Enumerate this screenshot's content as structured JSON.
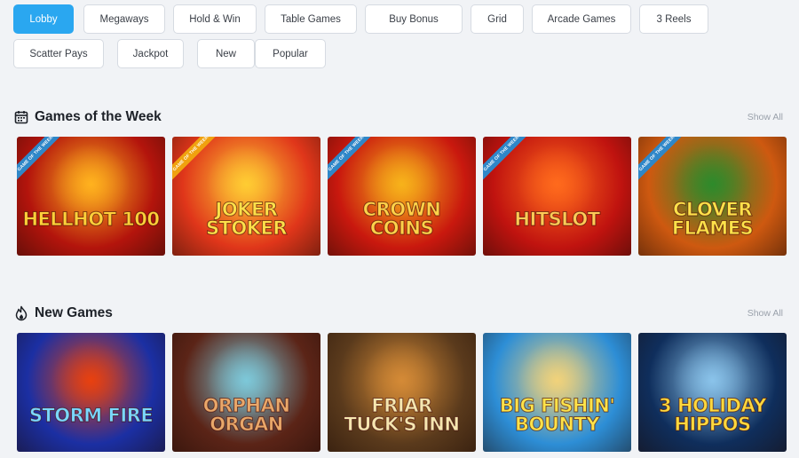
{
  "filters": [
    {
      "label": "Lobby",
      "active": true
    },
    {
      "label": "Megaways",
      "active": false
    },
    {
      "label": "Hold & Win",
      "active": false
    },
    {
      "label": "Table Games",
      "active": false
    },
    {
      "label": "Buy Bonus",
      "active": false
    },
    {
      "label": "Grid",
      "active": false
    },
    {
      "label": "Arcade Games",
      "active": false
    },
    {
      "label": "3 Reels",
      "active": false
    },
    {
      "label": "Scatter Pays",
      "active": false
    },
    {
      "label": "Jackpot",
      "active": false
    },
    {
      "label": "New",
      "active": false
    },
    {
      "label": "Popular",
      "active": false
    }
  ],
  "sections": {
    "week": {
      "title": "Games of the Week",
      "icon": "calendar-icon",
      "show_all": "Show All",
      "ribbon": "GAME OF THE WEEK",
      "games": [
        {
          "title": "HellHot 100",
          "bg": "#b3140c",
          "accent": "#ffb21e",
          "text": "#ffd03a"
        },
        {
          "title": "Joker Stoker",
          "bg": "#e0361a",
          "accent": "#ffcc33",
          "text": "#ffe04a"
        },
        {
          "title": "Crown Coins",
          "bg": "#c9180e",
          "accent": "#f7b21a",
          "text": "#ffd24a"
        },
        {
          "title": "Hitslot",
          "bg": "#c0130f",
          "accent": "#ff6a1c",
          "text": "#ffcb57"
        },
        {
          "title": "Clover Flames",
          "bg": "#ce5910",
          "accent": "#2e8a2b",
          "text": "#ffe24a"
        }
      ]
    },
    "new": {
      "title": "New Games",
      "icon": "flame-icon",
      "show_all": "Show All",
      "games": [
        {
          "title": "Storm Fire",
          "bg": "#1b2fa3",
          "accent": "#e8410f",
          "text": "#7ad8ff"
        },
        {
          "title": "Orphan Organ",
          "bg": "#5b2417",
          "accent": "#7dc8d9",
          "text": "#e9a86a"
        },
        {
          "title": "Friar Tuck's Inn",
          "bg": "#5a3a1c",
          "accent": "#d48a36",
          "text": "#f6e7b0"
        },
        {
          "title": "Big Fishin' Bounty",
          "bg": "#2d8ed6",
          "accent": "#f1d27a",
          "text": "#ffe34a"
        },
        {
          "title": "3 Holiday Hippos",
          "bg": "#0f2e5c",
          "accent": "#8ac3ea",
          "text": "#ffd93e"
        }
      ]
    }
  }
}
